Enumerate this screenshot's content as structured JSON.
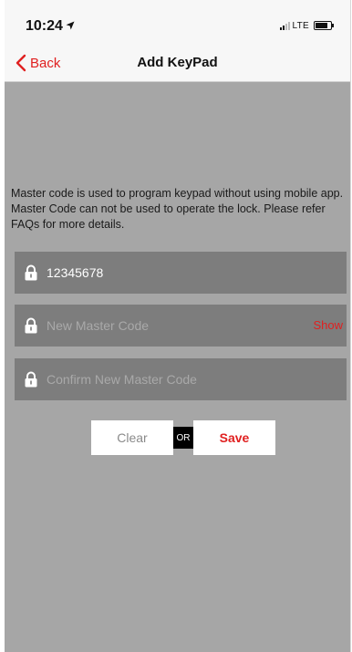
{
  "status_bar": {
    "time": "10:24",
    "network": "LTE"
  },
  "nav": {
    "back_label": "Back",
    "title": "Add KeyPad"
  },
  "description": "Master code is used to program keypad without using mobile app. Master Code can not be used to operate the lock. Please refer FAQs for more details.",
  "fields": {
    "current_code_value": "12345678",
    "new_code_placeholder": "New Master Code",
    "show_label": "Show",
    "confirm_code_placeholder": "Confirm New Master Code"
  },
  "actions": {
    "clear_label": "Clear",
    "or_label": "OR",
    "save_label": "Save"
  },
  "colors": {
    "accent": "#e02020",
    "background": "#a6a6a6",
    "field": "#7d7d7d"
  }
}
